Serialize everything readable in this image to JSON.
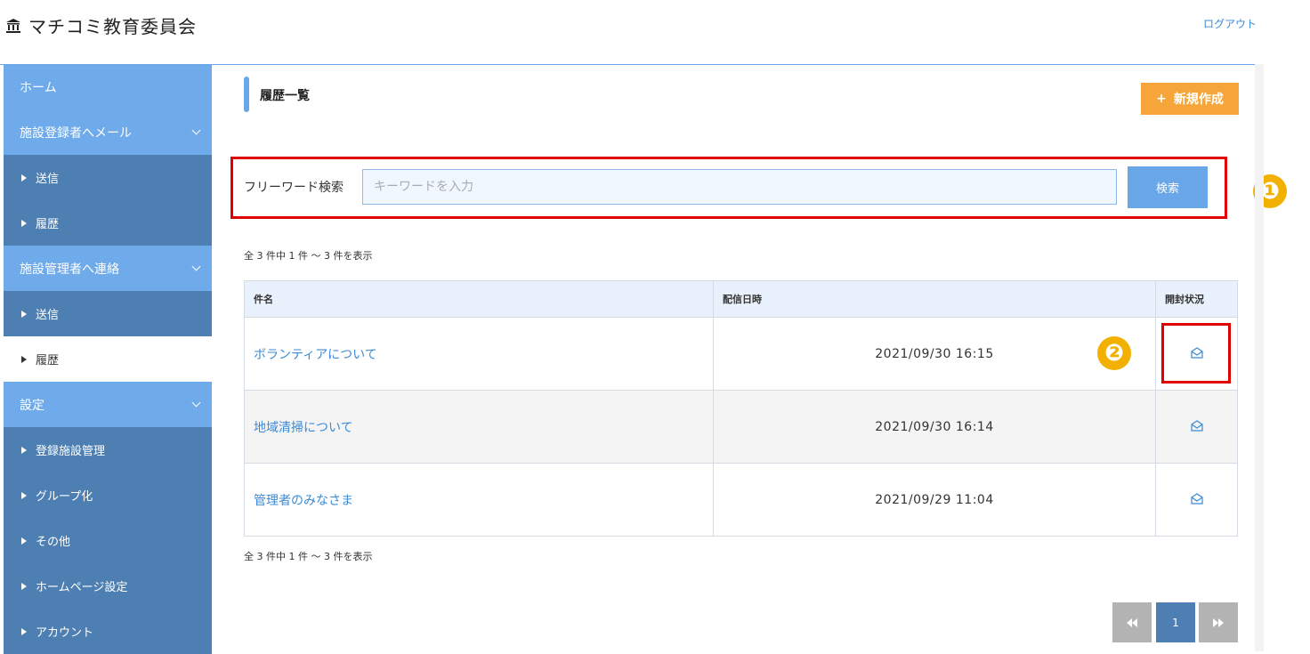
{
  "header": {
    "brand": "マチコミ教育委員会",
    "logout": "ログアウト"
  },
  "sidebar": {
    "home": "ホーム",
    "group1": {
      "label": "施設登録者へメール",
      "items": [
        "送信",
        "履歴"
      ]
    },
    "group2": {
      "label": "施設管理者へ連絡",
      "items": [
        "送信",
        "履歴"
      ]
    },
    "group3": {
      "label": "設定",
      "items": [
        "登録施設管理",
        "グループ化",
        "その他",
        "ホームページ設定",
        "アカウント"
      ]
    }
  },
  "main": {
    "title": "履歴一覧",
    "new_button": "新規作成",
    "search": {
      "label": "フリーワード検索",
      "placeholder": "キーワードを入力",
      "button": "検索"
    },
    "count_text": "全 3 件中 1 件 ～ 3 件を表示",
    "table": {
      "headers": [
        "件名",
        "配信日時",
        "開封状況"
      ],
      "rows": [
        {
          "subject": "ボランティアについて",
          "date": "2021/09/30 16:15"
        },
        {
          "subject": "地域清掃について",
          "date": "2021/09/30 16:14"
        },
        {
          "subject": "管理者のみなさま",
          "date": "2021/09/29 11:04"
        }
      ]
    },
    "pagination": {
      "current": "1"
    },
    "badges": [
      "❶",
      "❷"
    ]
  },
  "colors": {
    "accent": "#6faaea",
    "sidebar_sub": "#4e7fb2",
    "new_button": "#f5a53a",
    "highlight": "#e00000",
    "badge": "#f2b100"
  }
}
